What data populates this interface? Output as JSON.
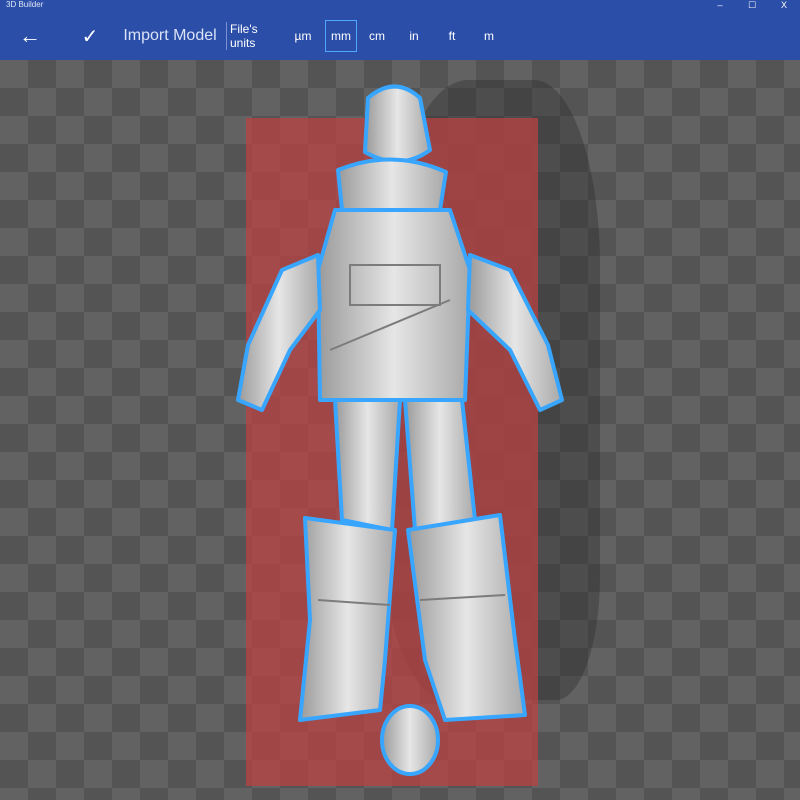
{
  "window": {
    "title": "3D Builder",
    "controls": [
      "–",
      "☐",
      "X"
    ]
  },
  "toolbar": {
    "back_icon": "back-arrow-icon",
    "confirm_icon": "checkmark-icon",
    "import_label": "Import Model",
    "units_label": "File's units",
    "units": [
      "µm",
      "mm",
      "cm",
      "in",
      "ft",
      "m"
    ],
    "selected_unit": "mm"
  },
  "colors": {
    "toolbar": "#2b4ea8",
    "selection_outline": "#38a6ff",
    "build_plate": "#be4141"
  }
}
